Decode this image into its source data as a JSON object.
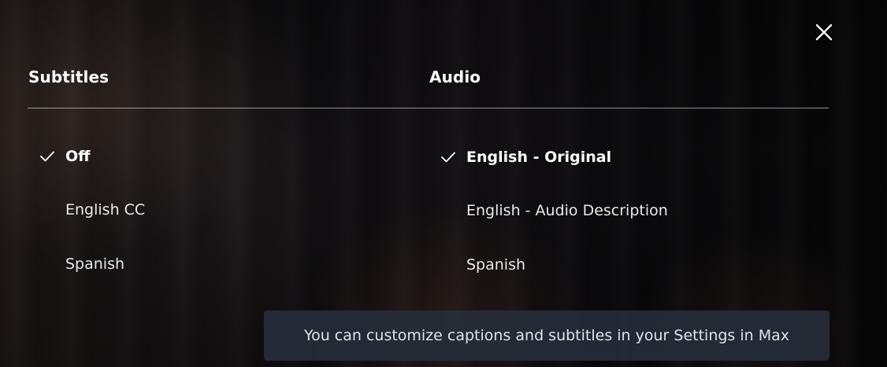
{
  "close": {
    "icon": "close-icon"
  },
  "subtitles": {
    "heading": "Subtitles",
    "options": [
      {
        "label": "Off",
        "selected": true
      },
      {
        "label": "English CC",
        "selected": false
      },
      {
        "label": "Spanish",
        "selected": false
      }
    ]
  },
  "audio": {
    "heading": "Audio",
    "options": [
      {
        "label": "English - Original",
        "selected": true
      },
      {
        "label": "English - Audio Description",
        "selected": false
      },
      {
        "label": "Spanish",
        "selected": false
      }
    ]
  },
  "toast": {
    "message": "You can customize captions and subtitles in your Settings in Max"
  },
  "colors": {
    "text": "#ffffff",
    "divider": "#8c8c8c",
    "toast_bg": "#262c38"
  }
}
